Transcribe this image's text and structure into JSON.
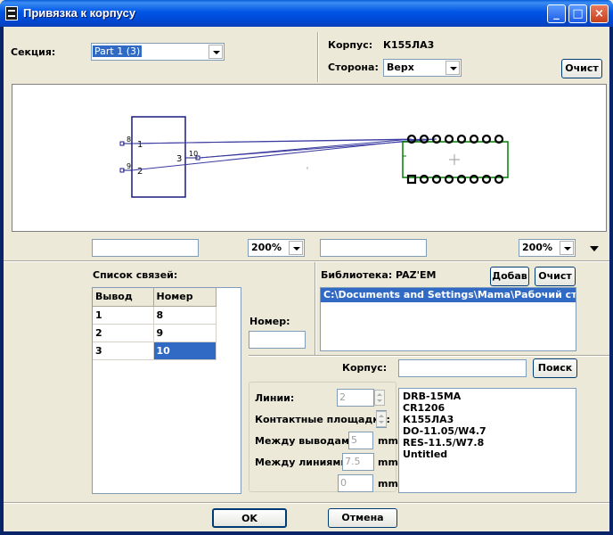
{
  "window": {
    "title": "Привязка к корпусу",
    "minimize": "_",
    "maximize": "□",
    "close": "×"
  },
  "section": {
    "label": "Секция:",
    "value": "Part 1 (3)"
  },
  "package": {
    "label": "Корпус:",
    "value": "К155ЛА3"
  },
  "side": {
    "label": "Сторона:",
    "value": "Верх"
  },
  "clear_top": "Очист",
  "symbol": {
    "pins": [
      {
        "num": "8",
        "label": "1"
      },
      {
        "num": "9",
        "label": "2"
      },
      {
        "num": "10",
        "label": "3"
      }
    ]
  },
  "zoom_left": {
    "text": "",
    "value": "200%"
  },
  "zoom_right": {
    "text": "",
    "value": "200%"
  },
  "links": {
    "title": "Список связей:",
    "columns": [
      "Вывод",
      "Номер"
    ],
    "rows": [
      {
        "pin": "1",
        "num": "8"
      },
      {
        "pin": "2",
        "num": "9"
      },
      {
        "pin": "3",
        "num": "10"
      }
    ]
  },
  "number": {
    "label": "Номер:",
    "value": ""
  },
  "library": {
    "label": "Библиотека: PAZ'EM",
    "add": "Добав",
    "clear": "Очист",
    "path": "C:\\Documents and Settings\\Mama\\Рабочий стол\\"
  },
  "case_search": {
    "label": "Корпус:",
    "value": "",
    "search": "Поиск"
  },
  "params": {
    "lines_label": "Линии:",
    "lines_value": "2",
    "pads_label": "Контактные площадки:",
    "pads_value": "",
    "between_pins_label": "Между выводами:",
    "between_pins_value": "5",
    "between_lines_label": "Между линиями:",
    "between_lines_value": "7.5",
    "offset_value": "0",
    "unit": "mm"
  },
  "cases": [
    "DRB-15MA",
    "CR1206",
    "К155ЛА3",
    "DO-11.05/W4.7",
    "RES-11.5/W7.8",
    "Untitled"
  ],
  "ok": "OK",
  "cancel": "Отмена"
}
